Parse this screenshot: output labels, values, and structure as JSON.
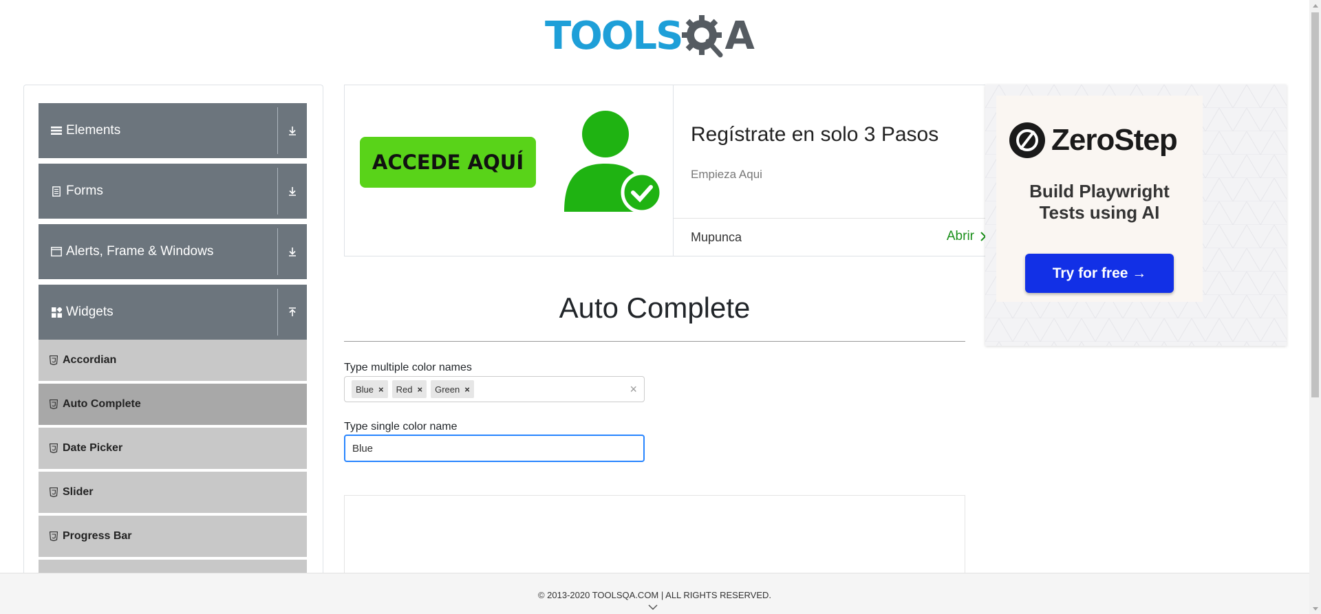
{
  "header": {
    "logo_part1": "TOOLS",
    "logo_part2": "A"
  },
  "sidebar": {
    "groups": [
      {
        "label": "Elements"
      },
      {
        "label": "Forms"
      },
      {
        "label": "Alerts, Frame & Windows"
      },
      {
        "label": "Widgets"
      }
    ],
    "widget_items": [
      {
        "label": "Accordian"
      },
      {
        "label": "Auto Complete"
      },
      {
        "label": "Date Picker"
      },
      {
        "label": "Slider"
      },
      {
        "label": "Progress Bar"
      }
    ]
  },
  "ad_banner": {
    "button_text": "ACCEDE AQUÍ",
    "title": "Regístrate en solo 3 Pasos",
    "subtitle": "Empieza Aqui",
    "brand": "Mupunca",
    "open_label": "Abrir",
    "accent_color": "#59d319"
  },
  "side_ad": {
    "brand": "ZeroStep",
    "tagline_line1": "Build Playwright",
    "tagline_line2": "Tests using AI",
    "button": "Try for free →",
    "button_color": "#1230e6"
  },
  "main": {
    "title": "Auto Complete",
    "multi_label": "Type multiple color names",
    "multi_values": [
      "Blue",
      "Red",
      "Green"
    ],
    "chip_remove": "×",
    "clear": "×",
    "single_label": "Type single color name",
    "single_value": "Blue"
  },
  "footer": {
    "text": "© 2013-2020 TOOLSQA.COM | ALL RIGHTS RESERVED."
  }
}
